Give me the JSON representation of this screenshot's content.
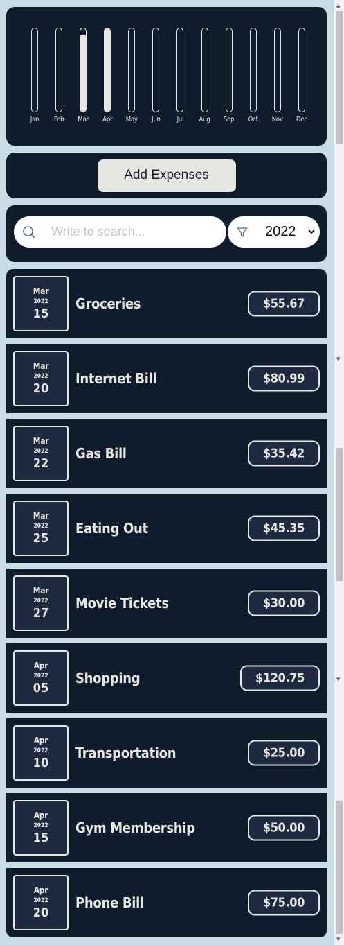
{
  "chart": {
    "months": [
      {
        "label": "Jan",
        "fill": 0
      },
      {
        "label": "Feb",
        "fill": 0
      },
      {
        "label": "Mar",
        "fill": 0.92
      },
      {
        "label": "Apr",
        "fill": 1.0
      },
      {
        "label": "May",
        "fill": 0
      },
      {
        "label": "Jun",
        "fill": 0
      },
      {
        "label": "Jul",
        "fill": 0
      },
      {
        "label": "Aug",
        "fill": 0
      },
      {
        "label": "Sep",
        "fill": 0
      },
      {
        "label": "Oct",
        "fill": 0
      },
      {
        "label": "Nov",
        "fill": 0
      },
      {
        "label": "Dec",
        "fill": 0
      }
    ]
  },
  "add_button": {
    "label": "Add Expenses"
  },
  "search": {
    "placeholder": "Write to search..."
  },
  "filter": {
    "year": "2022"
  },
  "expenses": [
    {
      "month": "Mar",
      "year": "2022",
      "day": "15",
      "title": "Groceries",
      "amount": "$55.67"
    },
    {
      "month": "Mar",
      "year": "2022",
      "day": "20",
      "title": "Internet Bill",
      "amount": "$80.99"
    },
    {
      "month": "Mar",
      "year": "2022",
      "day": "22",
      "title": "Gas Bill",
      "amount": "$35.42"
    },
    {
      "month": "Mar",
      "year": "2022",
      "day": "25",
      "title": "Eating Out",
      "amount": "$45.35"
    },
    {
      "month": "Mar",
      "year": "2022",
      "day": "27",
      "title": "Movie Tickets",
      "amount": "$30.00"
    },
    {
      "month": "Apr",
      "year": "2022",
      "day": "05",
      "title": "Shopping",
      "amount": "$120.75"
    },
    {
      "month": "Apr",
      "year": "2022",
      "day": "10",
      "title": "Transportation",
      "amount": "$25.00"
    },
    {
      "month": "Apr",
      "year": "2022",
      "day": "15",
      "title": "Gym Membership",
      "amount": "$50.00"
    },
    {
      "month": "Apr",
      "year": "2022",
      "day": "20",
      "title": "Phone Bill",
      "amount": "$75.00"
    }
  ],
  "colors": {
    "background": "#c9dbe4",
    "panel": "#0f1c2c",
    "accent": "#e6e6e2"
  }
}
